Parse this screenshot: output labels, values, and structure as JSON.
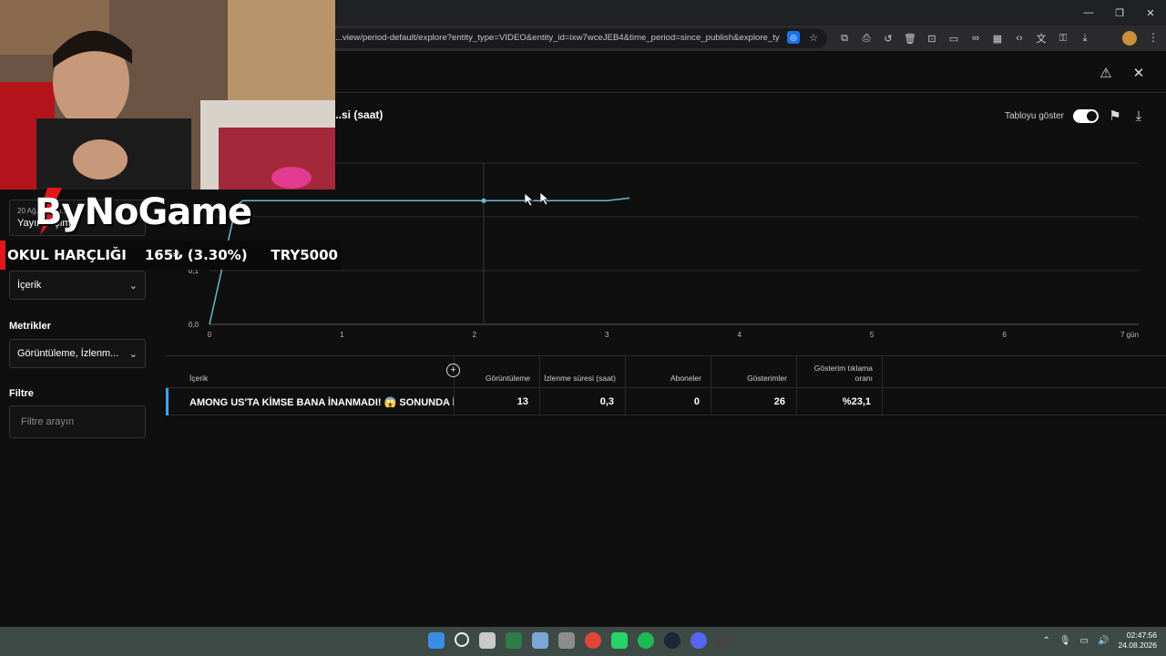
{
  "browser": {
    "url": "...view/period-default/explore?entity_type=VIDEO&entity_id=ixw7wceJEB4&time_period=since_publish&explore_type...",
    "window_controls": [
      "—",
      "❐",
      "✕"
    ]
  },
  "header": {
    "chart_title": "...si (saat)",
    "table_toggle_label": "Tabloyu göster"
  },
  "sidebar": {
    "date_small": "20 Ağ... - Şim...",
    "date_main": "Yayın... Şimdi",
    "content_select": "İçerik",
    "metrics_label": "Metrikler",
    "metrics_select": "Görüntüleme, İzlenm...",
    "filter_label": "Filtre",
    "filter_placeholder": "Filtre arayın"
  },
  "chart_data": {
    "type": "line",
    "x": [
      0,
      0.2,
      0.25,
      2.07,
      2.5,
      3.0,
      3.17
    ],
    "values": [
      0.0,
      0.22,
      0.23,
      0.23,
      0.23,
      0.23,
      0.235
    ],
    "x_ticks": [
      "0",
      "1",
      "2",
      "3",
      "4",
      "5",
      "6",
      "7 gün"
    ],
    "y_ticks": [
      "0,0",
      "0,1"
    ],
    "xlim": [
      0,
      7
    ],
    "ylim": [
      0,
      0.3
    ],
    "color": "#6fb7d4",
    "marker_x": 2.07
  },
  "table": {
    "columns": [
      "İçerik",
      "Görüntüleme",
      "İzlenme süresi (saat)",
      "Aboneler",
      "Gösterimler",
      "Gösterim tıklama oranı"
    ],
    "row": {
      "title": "AMONG US'TA KİMSE BANA İNANMADI! 😱 SONUNDA İM...",
      "views": "13",
      "watch_time": "0,3",
      "subscribers": "0",
      "impressions": "26",
      "ctr": "%23,1"
    }
  },
  "overlay": {
    "logo": "ByNoGame",
    "ticker_label": "OKUL HARÇLIĞI",
    "ticker_amount": "165₺ (3.30%)",
    "ticker_goal": "TRY5000"
  },
  "taskbar": {
    "time": "02:47:56",
    "date": "24.08.2026"
  },
  "colors": {
    "accent": "#3ea6ff",
    "line": "#6fb7d4",
    "ticker_red": "#e0181b"
  }
}
